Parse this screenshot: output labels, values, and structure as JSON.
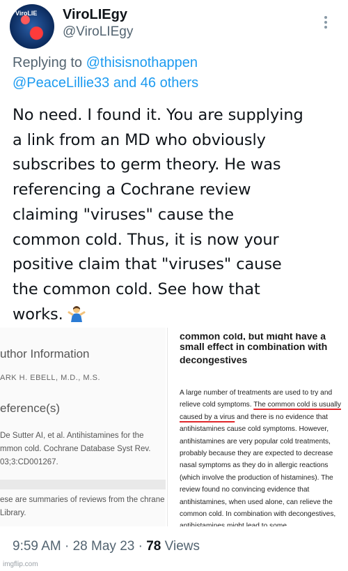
{
  "author": {
    "display_name": "ViroLIEgy",
    "handle": "@ViroLIEgy",
    "avatar_text": "ViroLIE"
  },
  "reply": {
    "prefix": "Replying to ",
    "mention_1": "@thisisnothappen",
    "mention_2": "@PeaceLillie33",
    "suffix": " and 46 others"
  },
  "tweet": {
    "text": "No need. I found it. You are supplying\na link from an MD who obviously\nsubscribes to germ theory. He was\nreferencing a Cochrane review\nclaiming \"viruses\" cause the\ncommon cold. Thus, it is now your\npositive claim that \"viruses\" cause\nthe common cold. See how that\nworks.",
    "emoji": "person-shrugging"
  },
  "image_left": {
    "heading_1": "uthor Information",
    "author_line": "ARK H. EBELL, M.D., M.S.",
    "heading_2": "eference(s)",
    "citation": "De Sutter AI, et al. Antihistamines for the mmon cold. Cochrane Database Syst Rev. 03;3:CD001267.",
    "note": "ese are summaries of reviews from the chrane Library."
  },
  "image_right": {
    "heading_cut": "common cold, but might have a",
    "heading": "small effect in combination with decongestives",
    "para_a": "A large number of treatments are used to try and relieve cold symptoms. ",
    "para_ul": "The common cold is usually caused by a virus",
    "para_b": " and there is no evidence that antihistamines cause cold symptoms. However, antihistamines are very popular cold treatments, probably because they are expected to decrease nasal symptoms as they do in allergic reactions (which involve the production of histamines). The review found no convincing evidence that antihistamines, when used alone, can relieve the common cold. In combination with decongestives, antihistamines might lead to some"
  },
  "footer": {
    "time": "9:59 AM",
    "sep1": " · ",
    "date": "28 May 23",
    "sep2": " · ",
    "views_count": "78",
    "views_label": " Views"
  },
  "watermark": "imgflip.com"
}
